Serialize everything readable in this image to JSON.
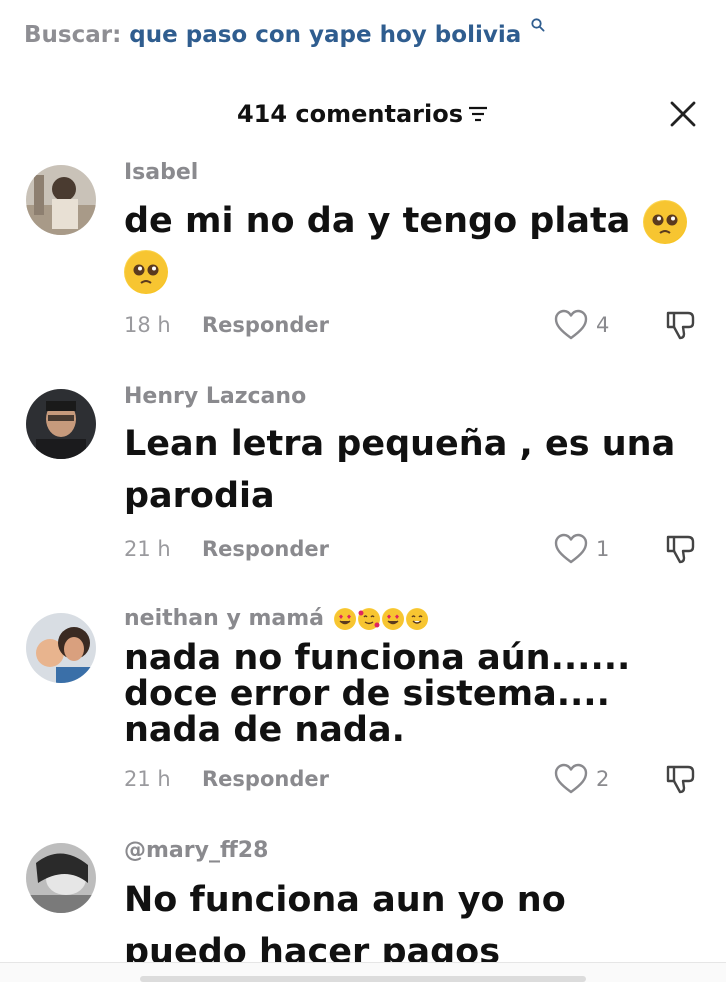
{
  "search": {
    "label": "Buscar:",
    "query": "que paso con yape hoy bolivia",
    "icon": "search-icon"
  },
  "header": {
    "count_label": "414 comentarios",
    "filter_icon": "filter-icon",
    "close_icon": "close-icon"
  },
  "comments": [
    {
      "user": "Isabel",
      "text_line1": "de mi no da y tengo plata",
      "text_emoji": "pleading-face",
      "time": "18 h",
      "reply_label": "Responder",
      "likes": "4"
    },
    {
      "user": "Henry Lazcano",
      "text_line1": "Lean letra pequeña , es una",
      "text_line2": "parodia",
      "time": "21 h",
      "reply_label": "Responder",
      "likes": "1"
    },
    {
      "user": "neithan y mamá",
      "user_emojis": [
        "heart-eyes",
        "smiling-hearts",
        "heart-eyes",
        "blushing-smile"
      ],
      "text_line1": "nada no funciona aún......",
      "text_line2": "doce error de sistema....",
      "text_line3": "nada de nada.",
      "time": "21 h",
      "reply_label": "Responder",
      "likes": "2"
    },
    {
      "user": "@mary_ff28",
      "text_line1": "No funciona aun yo no",
      "text_line2": "puedo hacer pagos"
    }
  ],
  "colors": {
    "link_blue": "#2f5d8f",
    "muted_gray": "#8a8a8e",
    "text_dark": "#111111"
  }
}
